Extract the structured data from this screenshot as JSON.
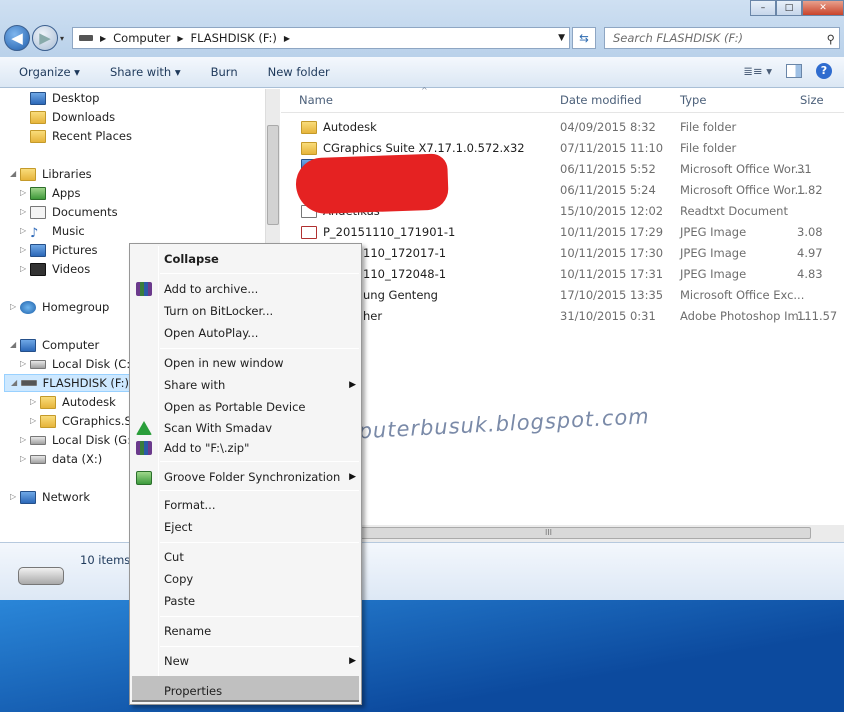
{
  "window": {
    "address_crumbs": [
      "Computer",
      "FLASHDISK (F:)"
    ],
    "search_placeholder": "Search FLASHDISK (F:)",
    "min_label": "–",
    "max_label": "□",
    "close_label": "✕"
  },
  "toolbar": {
    "organize": "Organize ▾",
    "share_with": "Share with ▾",
    "burn": "Burn",
    "new_folder": "New folder",
    "view_icon": "≣≡ ▾",
    "help_label": "?"
  },
  "nav": {
    "desktop": "Desktop",
    "downloads": "Downloads",
    "recent_places": "Recent Places",
    "libraries": "Libraries",
    "apps": "Apps",
    "documents": "Documents",
    "music": "Music",
    "pictures": "Pictures",
    "videos": "Videos",
    "homegroup": "Homegroup",
    "computer": "Computer",
    "local_c": "Local Disk (C:)",
    "flashdisk": "FLASHDISK (F:)",
    "autodesk": "Autodesk",
    "cgraphics": "CGraphics.Sui",
    "local_g": "Local Disk (G:)",
    "data_x": "data (X:)",
    "network": "Network"
  },
  "columns": {
    "name": "Name",
    "date": "Date modified",
    "type": "Type",
    "size": "Size"
  },
  "files": [
    {
      "name": "Autodesk",
      "date": "04/09/2015 8:32",
      "type": "File folder",
      "size": ""
    },
    {
      "name": "CGraphics Suite X7.17.1.0.572.x32",
      "date": "07/11/2015 11:10",
      "type": "File folder",
      "size": ""
    },
    {
      "name": "",
      "date": "06/11/2015 5:52",
      "type": "Microsoft Office Wor...",
      "size": "31"
    },
    {
      "name": "",
      "date": "06/11/2015 5:24",
      "type": "Microsoft Office Wor...",
      "size": "1.82"
    },
    {
      "name": "Andetikas",
      "date": "15/10/2015 12:02",
      "type": "Readtxt Document",
      "size": ""
    },
    {
      "name": "P_20151110_171901-1",
      "date": "10/11/2015 17:29",
      "type": "JPEG Image",
      "size": "3.08"
    },
    {
      "name": "110_172017-1",
      "date": "10/11/2015 17:30",
      "type": "JPEG Image",
      "size": "4.97"
    },
    {
      "name": "110_172048-1",
      "date": "10/11/2015 17:31",
      "type": "JPEG Image",
      "size": "4.83"
    },
    {
      "name": "ung Genteng",
      "date": "17/10/2015 13:35",
      "type": "Microsoft Office Exc...",
      "size": ""
    },
    {
      "name": "her",
      "date": "31/10/2015 0:31",
      "type": "Adobe Photoshop Im...",
      "size": "111.57"
    }
  ],
  "status": {
    "items_count": "10 items"
  },
  "watermark": "komputerbusuk.blogspot.com",
  "context_menu": {
    "collapse": "Collapse",
    "add_archive": "Add to archive...",
    "bitlocker": "Turn on BitLocker...",
    "autoplay": "Open AutoPlay...",
    "new_window": "Open in new window",
    "share_with": "Share with",
    "portable": "Open as Portable Device",
    "smadav": "Scan With Smadav",
    "add_zip": "Add to \"F:\\.zip\"",
    "groove": "Groove Folder Synchronization",
    "format": "Format...",
    "eject": "Eject",
    "cut": "Cut",
    "copy": "Copy",
    "paste": "Paste",
    "rename": "Rename",
    "new": "New",
    "properties": "Properties"
  }
}
